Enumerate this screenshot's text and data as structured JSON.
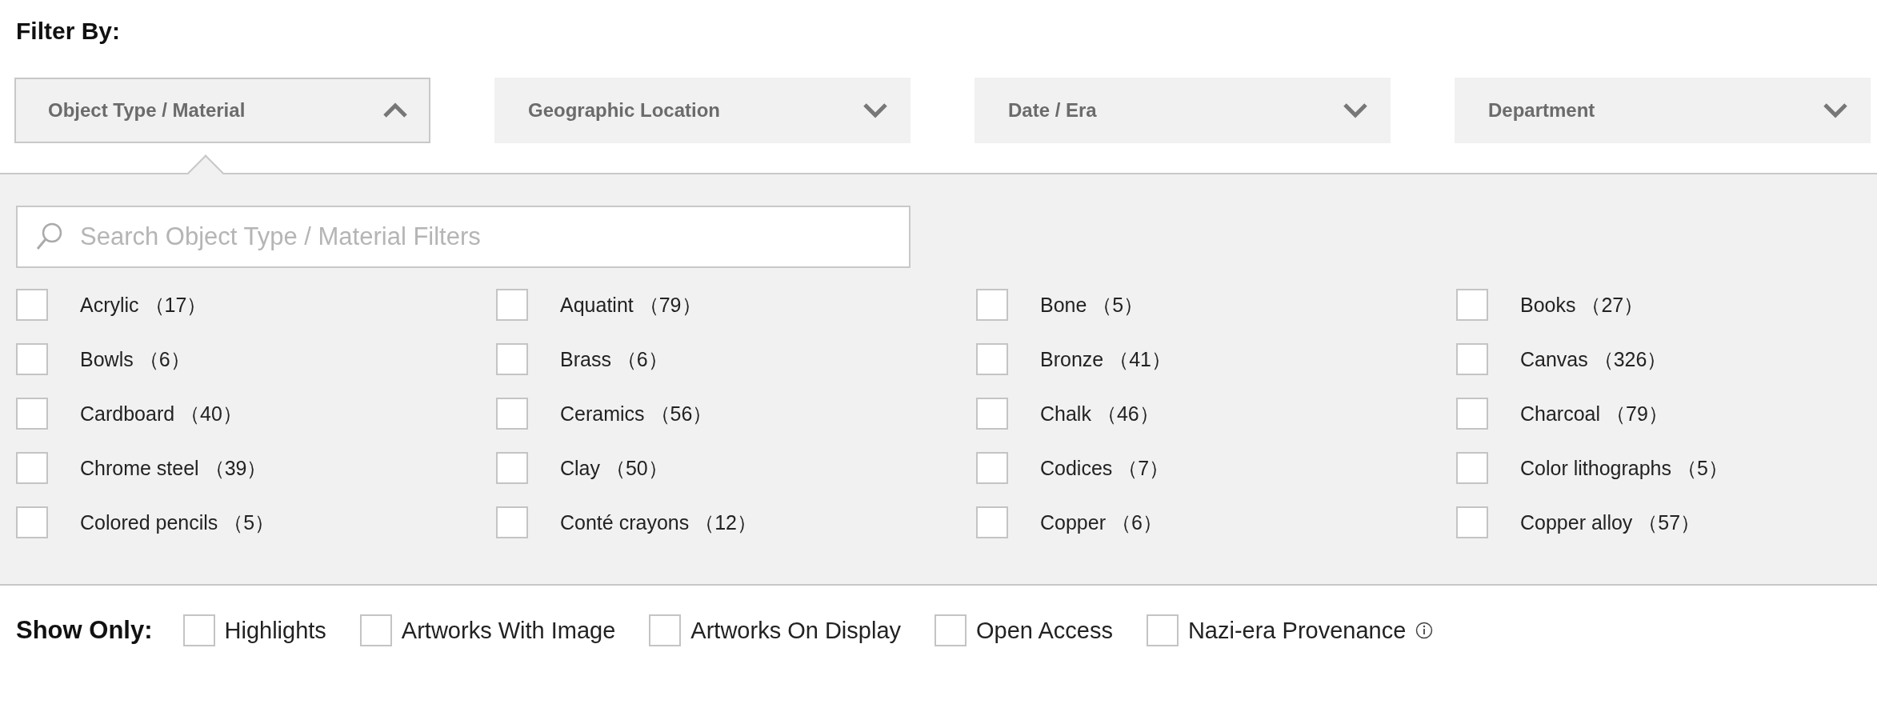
{
  "filter_by": {
    "title": "Filter By:"
  },
  "dropdowns": [
    {
      "label": "Object Type / Material",
      "expanded": true
    },
    {
      "label": "Geographic Location",
      "expanded": false
    },
    {
      "label": "Date / Era",
      "expanded": false
    },
    {
      "label": "Department",
      "expanded": false
    }
  ],
  "panel": {
    "search": {
      "placeholder": "Search Object Type / Material Filters"
    },
    "options": [
      {
        "name": "Acrylic",
        "count": "（17）",
        "checked": false
      },
      {
        "name": "Aquatint",
        "count": "（79）",
        "checked": false
      },
      {
        "name": "Bone",
        "count": "（5）",
        "checked": false
      },
      {
        "name": "Books",
        "count": "（27）",
        "checked": false
      },
      {
        "name": "Bowls",
        "count": "（6）",
        "checked": false
      },
      {
        "name": "Brass",
        "count": "（6）",
        "checked": false
      },
      {
        "name": "Bronze",
        "count": "（41）",
        "checked": false
      },
      {
        "name": "Canvas",
        "count": "（326）",
        "checked": false
      },
      {
        "name": "Cardboard",
        "count": "（40）",
        "checked": false
      },
      {
        "name": "Ceramics",
        "count": "（56）",
        "checked": false
      },
      {
        "name": "Chalk",
        "count": "（46）",
        "checked": false
      },
      {
        "name": "Charcoal",
        "count": "（79）",
        "checked": false
      },
      {
        "name": "Chrome steel",
        "count": "（39）",
        "checked": false
      },
      {
        "name": "Clay",
        "count": "（50）",
        "checked": false
      },
      {
        "name": "Codices",
        "count": "（7）",
        "checked": false
      },
      {
        "name": "Color lithographs",
        "count": "（5）",
        "checked": false
      },
      {
        "name": "Colored pencils",
        "count": "（5）",
        "checked": false
      },
      {
        "name": "Conté crayons",
        "count": "（12）",
        "checked": false
      },
      {
        "name": "Copper",
        "count": "（6）",
        "checked": false
      },
      {
        "name": "Copper alloy",
        "count": "（57）",
        "checked": false
      }
    ]
  },
  "show_only": {
    "title": "Show Only:",
    "options": [
      {
        "label": "Highlights",
        "checked": false
      },
      {
        "label": "Artworks With Image",
        "checked": false
      },
      {
        "label": "Artworks On Display",
        "checked": false
      },
      {
        "label": "Open Access",
        "checked": false
      },
      {
        "label": "Nazi-era Provenance",
        "checked": false,
        "info": true
      }
    ]
  }
}
